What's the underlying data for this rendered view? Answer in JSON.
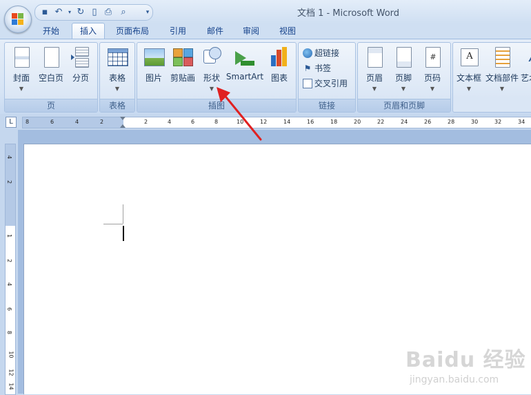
{
  "window": {
    "title": "文档 1 - Microsoft Word"
  },
  "quick_access": {
    "icons": [
      "save-icon",
      "undo-icon",
      "dropdown-arrow-icon",
      "redo-icon",
      "new-doc-icon",
      "print-icon",
      "print-preview-icon",
      "customize-icon"
    ]
  },
  "tabs": [
    {
      "label": "开始",
      "active": false
    },
    {
      "label": "插入",
      "active": true
    },
    {
      "label": "页面布局",
      "active": false
    },
    {
      "label": "引用",
      "active": false
    },
    {
      "label": "邮件",
      "active": false
    },
    {
      "label": "审阅",
      "active": false
    },
    {
      "label": "视图",
      "active": false
    }
  ],
  "ribbon": {
    "groups": {
      "pages": {
        "title": "页",
        "buttons": [
          "封面",
          "空白页",
          "分页"
        ]
      },
      "tables": {
        "title": "表格",
        "buttons": [
          "表格"
        ]
      },
      "illustrations": {
        "title": "插图",
        "buttons": [
          "图片",
          "剪贴画",
          "形状",
          "SmartArt",
          "图表"
        ]
      },
      "links": {
        "title": "链接",
        "buttons": [
          "超链接",
          "书签",
          "交叉引用"
        ]
      },
      "header_footer": {
        "title": "页眉和页脚",
        "buttons": [
          "页眉",
          "页脚",
          "页码"
        ]
      },
      "text": {
        "title": "",
        "buttons": [
          "文本框",
          "文档部件",
          "艺术"
        ]
      }
    }
  },
  "ruler": {
    "tab_selector": "L",
    "h_ticks": [
      "8",
      "6",
      "4",
      "2",
      "2",
      "4",
      "6",
      "8",
      "10",
      "12",
      "14",
      "16",
      "18",
      "20",
      "22",
      "24",
      "26",
      "28",
      "30",
      "32",
      "34"
    ],
    "v_ticks": [
      "4",
      "2",
      "1",
      "2",
      "4",
      "6",
      "8",
      "10",
      "12",
      "14"
    ]
  },
  "watermark": {
    "main": "Baidu 经验",
    "sub": "jingyan.baidu.com"
  },
  "colors": {
    "accent": "#15428b",
    "annotation_arrow": "#e02020"
  }
}
